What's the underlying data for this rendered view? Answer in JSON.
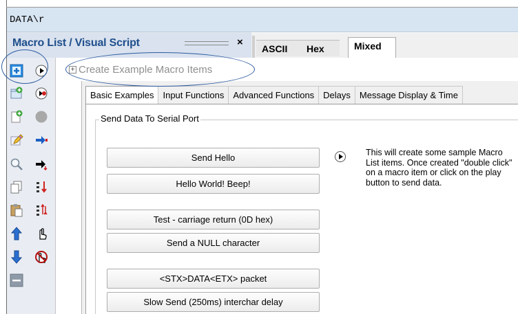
{
  "path_bar": {
    "text": "DATA\\r"
  },
  "macro_panel": {
    "title": "Macro List / Visual Script",
    "close_glyph": "×"
  },
  "view_tabs": [
    "ASCII",
    "Hex",
    "Mixed"
  ],
  "tree": {
    "plus_glyph": "+",
    "item_label": "Create Example Macro Items"
  },
  "sub_tabs": [
    "Basic Examples",
    "Input Functions",
    "Advanced Functions",
    "Delays",
    "Message Display & Time"
  ],
  "group": {
    "label": "Send Data To Serial Port",
    "buttons": [
      "Send Hello",
      "Hello World! Beep!",
      "Test - carriage return (0D hex)",
      "Send a NULL character",
      "<STX>DATA<ETX> packet",
      "Slow Send (250ms) interchar delay"
    ],
    "help_text": "This will create some sample Macro List items.  Once created \"double click\" on a macro item or click on the play button to send data."
  },
  "toolbar_icons": [
    "add-macro-icon",
    "play-icon",
    "new-folder-icon",
    "record-macro-icon",
    "new-document-icon",
    "stop-icon",
    "edit-icon",
    "send-arrow-icon",
    "find-icon",
    "send-down-arrow-icon",
    "copy-icon",
    "sort-down-icon",
    "paste-icon",
    "sort-updown-icon",
    "move-up-icon",
    "hand-cursor-icon",
    "move-down-icon",
    "no-hand-icon",
    "remove-icon"
  ],
  "colors": {
    "title_blue": "#1f4e8c",
    "path_bar_bg": "#d7e4f2",
    "annotation_blue": "#2c5aa0"
  }
}
